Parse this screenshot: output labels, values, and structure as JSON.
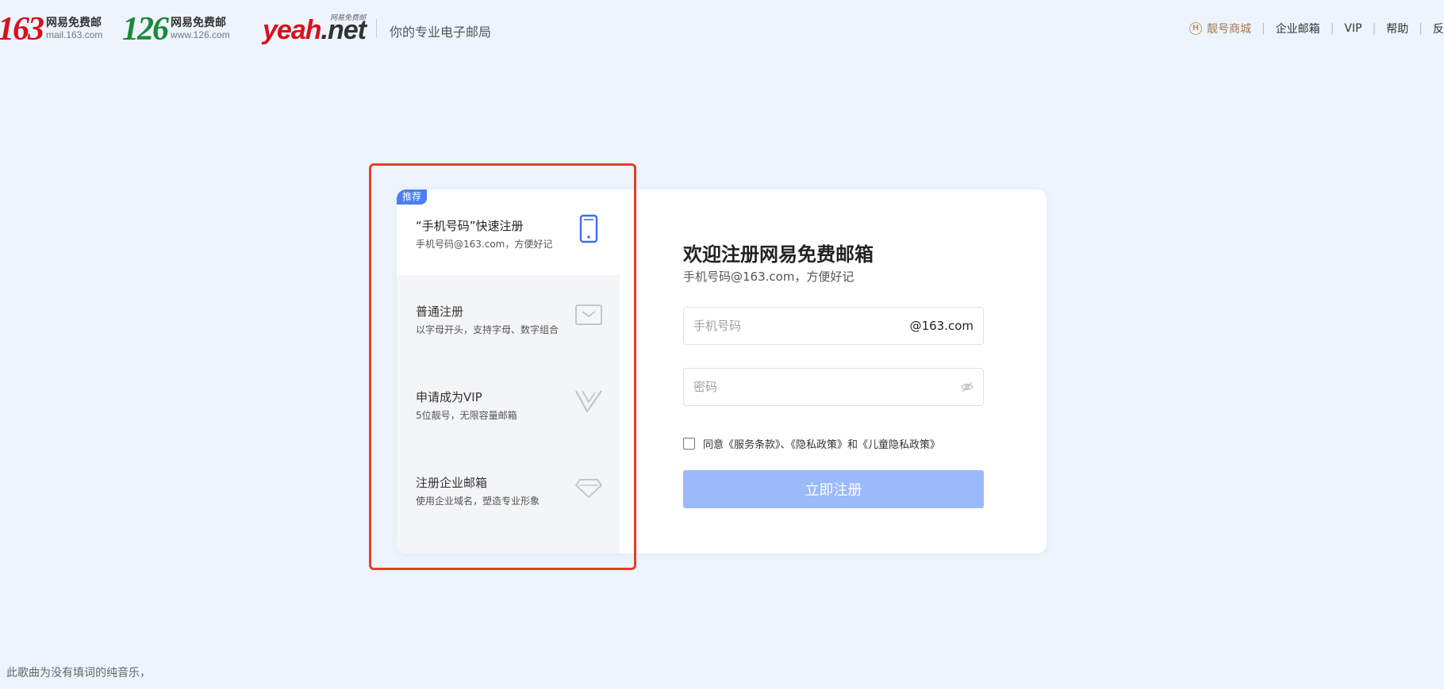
{
  "header": {
    "brands": [
      {
        "mark": "163",
        "name": "网易免费邮",
        "domain": "mail.163.com"
      },
      {
        "mark": "126",
        "name": "网易免费邮",
        "domain": "www.126.com"
      },
      {
        "mark_part1": "yeah",
        "mark_part2": ".net",
        "tag": "网易免费邮"
      }
    ],
    "slogan": "你的专业电子邮局",
    "nav": {
      "shop": "靓号商城",
      "enterprise": "企业邮箱",
      "vip": "VIP",
      "help": "帮助",
      "feedback": "反"
    }
  },
  "sidebar": {
    "badge": "推荐",
    "options": [
      {
        "title": "“手机号码”快速注册",
        "desc": "手机号码@163.com，方便好记",
        "icon": "phone-icon"
      },
      {
        "title": "普通注册",
        "desc": "以字母开头，支持字母、数字组合",
        "icon": "envelope-icon"
      },
      {
        "title": "申请成为VIP",
        "desc": "5位靓号，无限容量邮箱",
        "icon": "vip-icon"
      },
      {
        "title": "注册企业邮箱",
        "desc": "使用企业域名，塑造专业形象",
        "icon": "diamond-icon"
      }
    ]
  },
  "form": {
    "title": "欢迎注册网易免费邮箱",
    "subtitle": "手机号码@163.com，方便好记",
    "phone_placeholder": "手机号码",
    "phone_suffix": "@163.com",
    "password_placeholder": "密码",
    "agreement": "同意《服务条款》、《隐私政策》和《儿童隐私政策》",
    "submit": "立即注册"
  },
  "footer": {
    "text": "此歌曲为没有填词的纯音乐，"
  },
  "colors": {
    "accent": "#4a7ef6",
    "submit_disabled": "#9bb9fb",
    "highlight_border": "#e83c2a",
    "brand_163": "#d8101c",
    "brand_126": "#1b8a3a",
    "background": "#edf4fd"
  }
}
